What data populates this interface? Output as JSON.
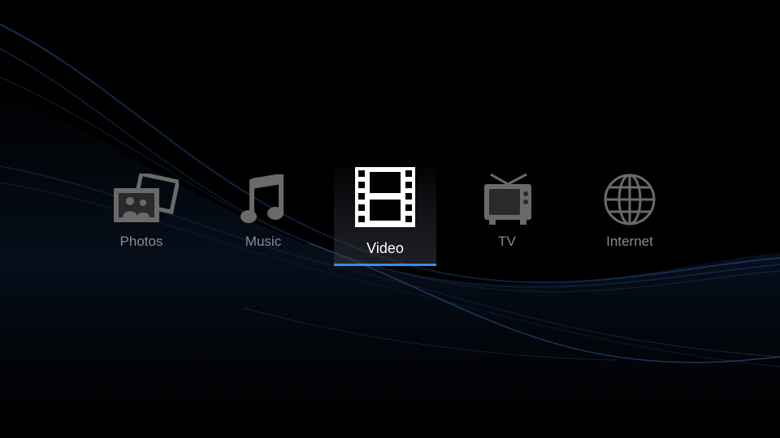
{
  "menu": {
    "items": [
      {
        "label": "Photos",
        "icon": "photos-icon",
        "selected": false
      },
      {
        "label": "Music",
        "icon": "music-note-icon",
        "selected": false
      },
      {
        "label": "Video",
        "icon": "film-strip-icon",
        "selected": true
      },
      {
        "label": "TV",
        "icon": "tv-icon",
        "selected": false
      },
      {
        "label": "Internet",
        "icon": "globe-icon",
        "selected": false
      }
    ]
  },
  "colors": {
    "background": "#000000",
    "wave": "#1c3d6b",
    "icon_inactive": "#6a6a6a",
    "icon_active": "#ffffff",
    "label_inactive": "#8b8b8b",
    "label_active": "#ffffff",
    "selection_underline": "#3a8fe0"
  }
}
